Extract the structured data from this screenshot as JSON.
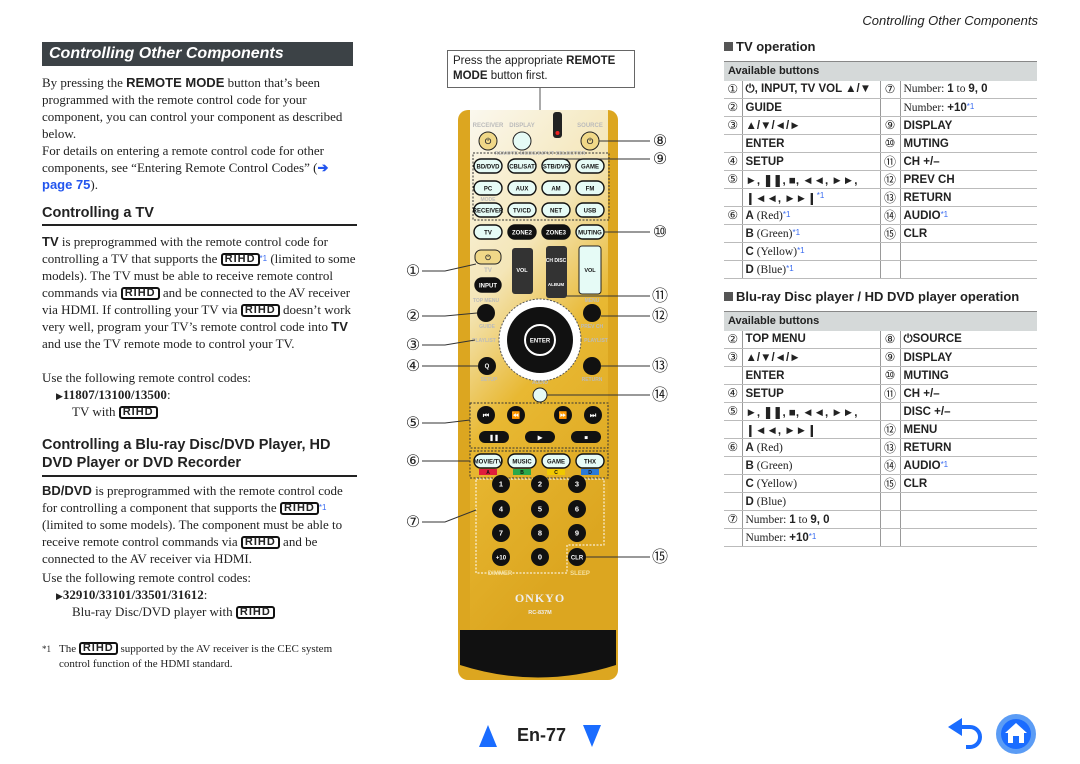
{
  "header": {
    "section": "Controlling Other Components"
  },
  "left": {
    "title": "Controlling Other Components",
    "intro_1a": "By pressing the ",
    "intro_1b": "REMOTE MODE",
    "intro_1c": " button that’s been programmed with the remote control code for your component, you can control your component as described below.",
    "intro_2a": "For details on entering a remote control code for other components, see “Entering Remote Control Codes” (",
    "intro_2link": "➔ page 75",
    "intro_2b": ").",
    "tv_heading": "Controlling a TV",
    "tv_p1a": "TV",
    "tv_p1b": " is preprogrammed with the remote control code for controlling a TV that supports the ",
    "tv_p1c": " (limited to some models). The TV must be able to receive remote control commands via ",
    "tv_p1d": " and be connected to the AV receiver via HDMI. If controlling your TV via ",
    "tv_p1e": " doesn’t work very well, program your TV’s remote control code into ",
    "tv_p1f": "TV",
    "tv_p1g": " and use the TV remote mode to control your TV.",
    "tv_use": "Use the following remote control codes:",
    "tv_codes": "11807/13100/13500",
    "tv_codes_desc": "TV with ",
    "bd_heading": "Controlling a Blu-ray Disc/DVD Player, HD DVD Player or DVD Recorder",
    "bd_p1a": "BD/DVD",
    "bd_p1b": " is preprogrammed with the remote control code for controlling a component that supports the ",
    "bd_p1c": " (limited to some models). The component must be able to receive remote control commands via ",
    "bd_p1d": " and be connected to the AV receiver via HDMI.",
    "bd_use": "Use the following remote control codes:",
    "bd_codes": "32910/33101/33501/31612",
    "bd_codes_desc": "Blu-ray Disc/DVD player with ",
    "rihd": "RIHD",
    "sup": "*1",
    "fn_mark": "*1",
    "fn_a": "The ",
    "fn_b": " supported by the AV receiver is the CEC system control function of the HDMI standard."
  },
  "remote": {
    "callout": "Press the appropriate REMOTE MODE button first.",
    "callout_a": "Press the appropriate ",
    "callout_b": "REMOTE",
    "callout_c": "MODE",
    "callout_d": " button first.",
    "top_labels": [
      "RECEIVER",
      "DISPLAY",
      "SOURCE"
    ],
    "group_label": "REMOTE MODE/INPUT SELECTOR",
    "mode_label": "MODE",
    "input_buttons": [
      "BD/DVD",
      "CBL/SAT",
      "STB/DVR",
      "GAME",
      "PC",
      "AUX",
      "AM",
      "FM",
      "RECEIVER",
      "TV/CD",
      "NET",
      "USB",
      "TV"
    ],
    "dark_buttons": [
      "ZONE2",
      "ZONE3"
    ],
    "muting": "MUTING",
    "tv_label": "TV",
    "input": "INPUT",
    "vol": "VOL",
    "ch": "CH DISC",
    "album": "ALBUM",
    "nav_labels": [
      "TOP MENU",
      "MENU",
      "GUIDE",
      "PREV CH",
      "PLAYLIST",
      "PLAYLIST",
      "SETUP",
      "RETURN",
      "AUDIO",
      "ENTER",
      "Q",
      "HOME"
    ],
    "color_buttons": [
      "MOVIE/TV",
      "MUSIC",
      "GAME",
      "THX"
    ],
    "color_keys": [
      "A",
      "B",
      "C",
      "D"
    ],
    "color_hex": [
      "#e01e3c",
      "#2aa84a",
      "#f0c800",
      "#2a7ad8"
    ],
    "numbers": [
      "1",
      "2",
      "3",
      "4",
      "5",
      "6",
      "7",
      "8",
      "9",
      "+10",
      "0",
      "CLR"
    ],
    "bottom_labels": [
      "DIMMER",
      "SLEEP"
    ],
    "brand": "ONKYO",
    "model": "RC-837M",
    "callouts_left": [
      "①",
      "②",
      "③",
      "④",
      "⑤",
      "⑥",
      "⑦"
    ],
    "callouts_right": [
      "⑧",
      "⑨",
      "⑩",
      "⑪",
      "⑫",
      "⑬",
      "⑭",
      "⑮"
    ]
  },
  "tv_table": {
    "section": "TV operation",
    "header": "Available buttons",
    "rows": [
      [
        "①",
        [
          [
            "b",
            "⏻, INPUT, TV VOL ▲/▼"
          ]
        ],
        "⑦",
        [
          [
            "r",
            "Number: "
          ],
          [
            "b",
            "1"
          ],
          [
            "r",
            " to "
          ],
          [
            "b",
            "9, 0"
          ]
        ]
      ],
      [
        "②",
        [
          [
            "b",
            "GUIDE"
          ]
        ],
        "",
        [
          [
            "r",
            "Number: "
          ],
          [
            "b",
            "+10"
          ],
          [
            "s",
            "*1"
          ]
        ]
      ],
      [
        "③",
        [
          [
            "b",
            "▲/▼/◄/►"
          ]
        ],
        "⑨",
        [
          [
            "b",
            "DISPLAY"
          ]
        ]
      ],
      [
        "",
        [
          [
            "b",
            "ENTER"
          ]
        ],
        "⑩",
        [
          [
            "b",
            "MUTING"
          ]
        ]
      ],
      [
        "④",
        [
          [
            "b",
            "SETUP"
          ]
        ],
        "⑪",
        [
          [
            "b",
            "CH +/–"
          ]
        ]
      ],
      [
        "⑤",
        [
          [
            "b",
            "►, ❚❚, ■, ◄◄, ►►,"
          ]
        ],
        "⑫",
        [
          [
            "b",
            "PREV CH"
          ]
        ]
      ],
      [
        "",
        [
          [
            "b",
            "❙◄◄, ►►❙"
          ],
          [
            "s",
            "*1"
          ]
        ],
        "⑬",
        [
          [
            "b",
            "RETURN"
          ]
        ]
      ],
      [
        "⑥",
        [
          [
            "b",
            "A"
          ],
          [
            "r",
            " (Red)"
          ],
          [
            "s",
            "*1"
          ]
        ],
        "⑭",
        [
          [
            "b",
            "AUDIO"
          ],
          [
            "s",
            "*1"
          ]
        ]
      ],
      [
        "",
        [
          [
            "b",
            "B"
          ],
          [
            "r",
            " (Green)"
          ],
          [
            "s",
            "*1"
          ]
        ],
        "⑮",
        [
          [
            "b",
            "CLR"
          ]
        ]
      ],
      [
        "",
        [
          [
            "b",
            "C"
          ],
          [
            "r",
            " (Yellow)"
          ],
          [
            "s",
            "*1"
          ]
        ],
        "",
        []
      ],
      [
        "",
        [
          [
            "b",
            "D"
          ],
          [
            "r",
            " (Blue)"
          ],
          [
            "s",
            "*1"
          ]
        ],
        "",
        []
      ]
    ]
  },
  "bd_table": {
    "section": "Blu-ray Disc player / HD DVD player operation",
    "header": "Available buttons",
    "rows": [
      [
        "②",
        [
          [
            "b",
            "TOP MENU"
          ]
        ],
        "⑧",
        [
          [
            "b",
            "⏻SOURCE"
          ]
        ]
      ],
      [
        "③",
        [
          [
            "b",
            "▲/▼/◄/►"
          ]
        ],
        "⑨",
        [
          [
            "b",
            "DISPLAY"
          ]
        ]
      ],
      [
        "",
        [
          [
            "b",
            "ENTER"
          ]
        ],
        "⑩",
        [
          [
            "b",
            "MUTING"
          ]
        ]
      ],
      [
        "④",
        [
          [
            "b",
            "SETUP"
          ]
        ],
        "⑪",
        [
          [
            "b",
            "CH +/–"
          ]
        ]
      ],
      [
        "⑤",
        [
          [
            "b",
            "►, ❚❚, ■, ◄◄, ►►,"
          ]
        ],
        "",
        [
          [
            "b",
            "DISC +/–"
          ]
        ]
      ],
      [
        "",
        [
          [
            "b",
            "❙◄◄, ►►❙"
          ]
        ],
        "⑫",
        [
          [
            "b",
            "MENU"
          ]
        ]
      ],
      [
        "⑥",
        [
          [
            "b",
            "A"
          ],
          [
            "r",
            " (Red)"
          ]
        ],
        "⑬",
        [
          [
            "b",
            "RETURN"
          ]
        ]
      ],
      [
        "",
        [
          [
            "b",
            "B"
          ],
          [
            "r",
            " (Green)"
          ]
        ],
        "⑭",
        [
          [
            "b",
            "AUDIO"
          ],
          [
            "s",
            "*1"
          ]
        ]
      ],
      [
        "",
        [
          [
            "b",
            "C"
          ],
          [
            "r",
            " (Yellow)"
          ]
        ],
        "⑮",
        [
          [
            "b",
            "CLR"
          ]
        ]
      ],
      [
        "",
        [
          [
            "b",
            "D"
          ],
          [
            "r",
            " (Blue)"
          ]
        ],
        "",
        []
      ],
      [
        "⑦",
        [
          [
            "r",
            "Number: "
          ],
          [
            "b",
            "1"
          ],
          [
            "r",
            " to "
          ],
          [
            "b",
            "9, 0"
          ]
        ],
        "",
        []
      ],
      [
        "",
        [
          [
            "r",
            "Number: "
          ],
          [
            "b",
            "+10"
          ],
          [
            "s",
            "*1"
          ]
        ],
        "",
        []
      ]
    ]
  },
  "footer": {
    "page": "En-77",
    "prev_icon": "triangle-up",
    "next_icon": "triangle-down",
    "back_icon": "undo-arrow",
    "home_icon": "home",
    "accent": "#1a6cff"
  }
}
